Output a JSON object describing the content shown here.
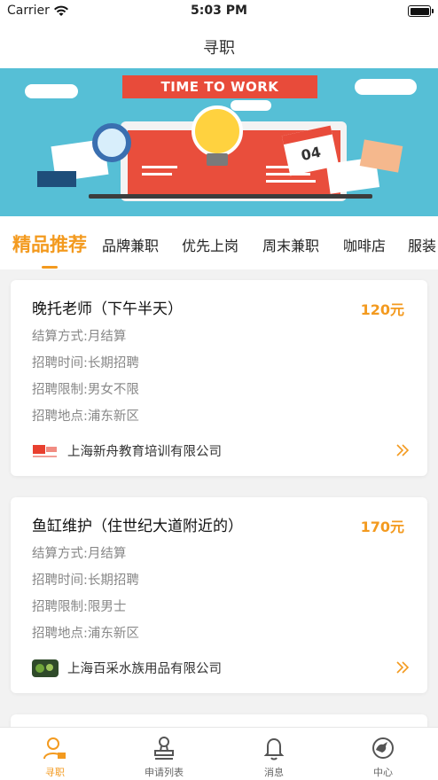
{
  "status_bar": {
    "carrier": "Carrier",
    "time": "5:03 PM"
  },
  "nav": {
    "title": "寻职"
  },
  "banner": {
    "headline": "TIME TO WORK",
    "calendar_day": "04"
  },
  "tabs": [
    {
      "label": "精品推荐",
      "active": true
    },
    {
      "label": "品牌兼职"
    },
    {
      "label": "优先上岗"
    },
    {
      "label": "周末兼职"
    },
    {
      "label": "咖啡店"
    },
    {
      "label": "服装"
    }
  ],
  "jobs": [
    {
      "title": "晚托老师（下午半天）",
      "price": "120元",
      "settlement": "结算方式:月结算",
      "recruit_time": "招聘时间:长期招聘",
      "restriction": "招聘限制:男女不限",
      "location": "招聘地点:浦东新区",
      "company": "上海新舟教育培训有限公司"
    },
    {
      "title": "鱼缸维护（住世纪大道附近的）",
      "price": "170元",
      "settlement": "结算方式:月结算",
      "recruit_time": "招聘时间:长期招聘",
      "restriction": "招聘限制:限男士",
      "location": "招聘地点:浦东新区",
      "company": "上海百采水族用品有限公司"
    }
  ],
  "tab_bar": [
    {
      "label": "寻职",
      "icon": "person-icon",
      "active": true
    },
    {
      "label": "申请列表",
      "icon": "stamp-icon"
    },
    {
      "label": "消息",
      "icon": "bell-icon"
    },
    {
      "label": "中心",
      "icon": "compass-icon"
    }
  ],
  "colors": {
    "accent": "#f39a1f",
    "banner_bg": "#56bfd6",
    "ribbon": "#e84b3a"
  }
}
